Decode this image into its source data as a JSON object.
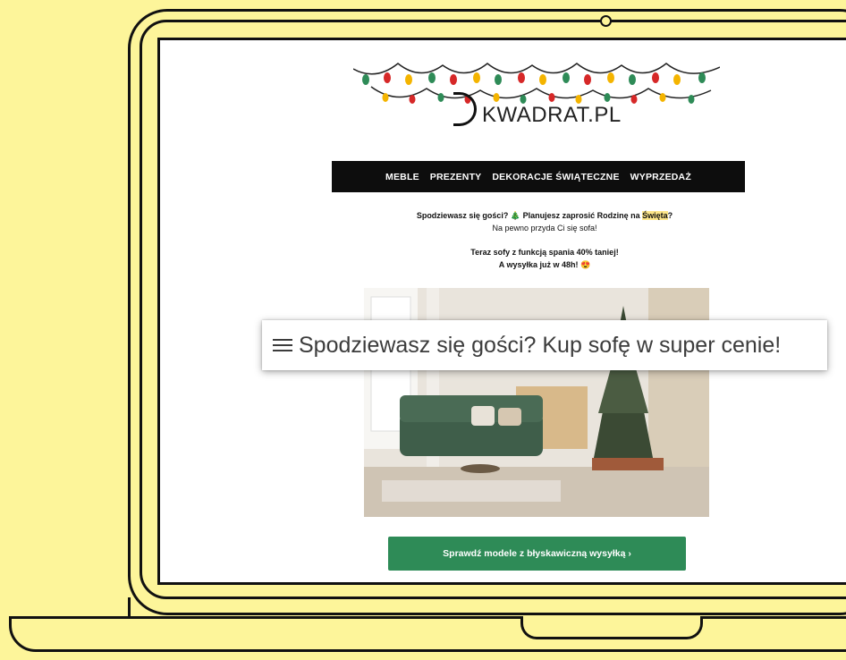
{
  "logo": {
    "text": "KWADRAT.PL"
  },
  "nav": {
    "items": [
      {
        "label": "MEBLE"
      },
      {
        "label": "PREZENTY"
      },
      {
        "label": "DEKORACJE ŚWIĄTECZNE"
      },
      {
        "label": "WYPRZEDAŻ"
      }
    ]
  },
  "intro": {
    "q1": "Spodziewasz się gości?",
    "tree_emoji": "🎄",
    "q2a": "Planujesz zaprosić Rodzinę na",
    "q2_highlight": "Święta",
    "q2_end": "?",
    "line2": "Na pewno przyda Ci się sofa!"
  },
  "promo": {
    "line1": "Teraz sofy z funkcją spania 40% taniej!",
    "line2": "A wysyłka już w 48h!",
    "emoji": "😍"
  },
  "cta": {
    "label": "Sprawdź modele z błyskawiczną wysyłką ›"
  },
  "subject": {
    "text": "Spodziewasz się gości? Kup sofę w super cenie!"
  },
  "icons": [
    "menu-icon",
    "christmas-lights-icon",
    "logo-mark-icon"
  ],
  "colors": {
    "background": "#fdf59a",
    "nav": "#0d0d0d",
    "cta": "#2e8b57",
    "highlight": "#fde68a"
  }
}
